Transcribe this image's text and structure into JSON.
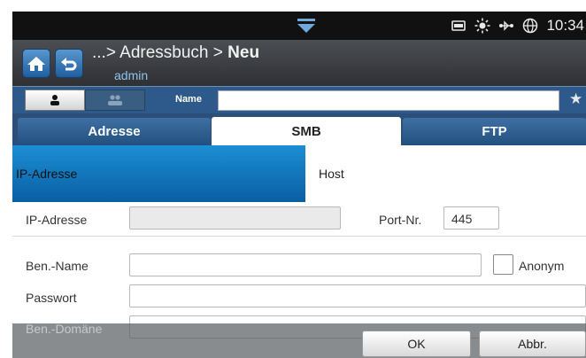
{
  "statusbar": {
    "time": "10:34",
    "icons": [
      "pull-down-tab-icon",
      "printer-icon",
      "brightness-icon",
      "network-icon",
      "globe-icon"
    ]
  },
  "header": {
    "breadcrumb_prefix": "...> Adressbuch > ",
    "breadcrumb_current": "Neu",
    "user": "admin"
  },
  "searchrow": {
    "name_label": "Name",
    "name_value": "",
    "star": "★"
  },
  "tabs": [
    {
      "label": "Adresse",
      "selected": false
    },
    {
      "label": "SMB",
      "selected": true
    },
    {
      "label": "FTP",
      "selected": false
    }
  ],
  "address_type": {
    "ip_label": "IP-Adresse",
    "host_label": "Host",
    "selected": "IP-Adresse"
  },
  "form": {
    "ip_label": "IP-Adresse",
    "ip_value": "",
    "port_label": "Port-Nr.",
    "port_value": "445",
    "user_label": "Ben.-Name",
    "user_value": "",
    "anonym_label": "Anonym",
    "password_label": "Passwort",
    "password_value": "",
    "domain_label": "Ben.-Domäne"
  },
  "buttons": {
    "ok": "OK",
    "cancel": "Abbr."
  },
  "colors": {
    "accent_blue": "#0a5ea3",
    "tab_blue": "#2b4f78"
  }
}
